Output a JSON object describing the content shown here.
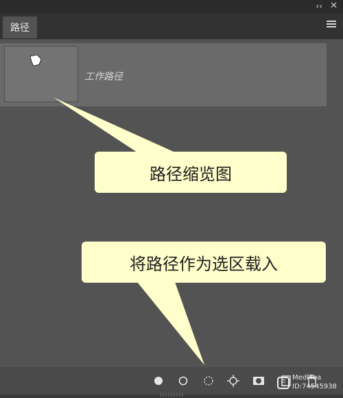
{
  "panel": {
    "tab_title": "路径",
    "topbar": {
      "collapse_glyph": "‹‹",
      "close_glyph": "✕"
    },
    "path_item": {
      "label": "工作路径"
    }
  },
  "annotations": {
    "thumbnail_callout": "路径缩览图",
    "load_selection_callout": "将路径作为选区载入"
  },
  "bottom_bar_icons": [
    "fill-path-icon",
    "stroke-path-icon",
    "load-selection-icon",
    "make-work-path-icon",
    "add-mask-icon",
    "new-path-icon",
    "delete-path-icon"
  ],
  "watermark": {
    "name": "MedPlea",
    "id": "ID:74545938"
  },
  "colors": {
    "panel_bg": "#535353",
    "selected_row": "#6a6a6a",
    "callout_bg": "#ffffcc"
  }
}
